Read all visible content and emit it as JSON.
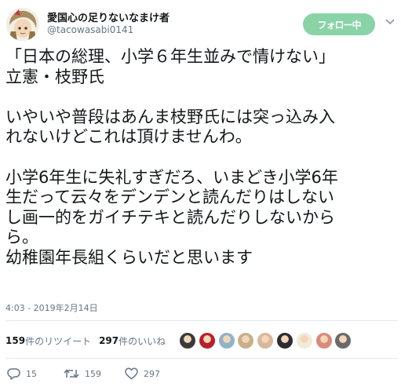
{
  "author": {
    "display_name": "愛国心の足りないなまけ者",
    "handle": "@tacowasabi0141",
    "follow_label": "フォロー中"
  },
  "tweet": {
    "lines": [
      "「日本の総理、小学６年生並みで情けない」",
      "立憲・枝野氏",
      "",
      "いやいや普段はあんま枝野氏には突っ込み入",
      "れないけどこれは頂けませんわ。",
      "",
      "小学6年生に失礼すぎだろ、いまどき小学6年",
      "生だって云々をデンデンと読んだりはしない",
      "し画一的をガイチテキと読んだりしないから",
      "ら。",
      "幼稚園年長組くらいだと思います"
    ],
    "timestamp": "4:03 - 2019年2月14日"
  },
  "stats": {
    "retweet_count": "159",
    "retweet_label": "件のリツイート",
    "like_count": "297",
    "like_label": "件のいいね"
  },
  "liker_avatars": [
    {
      "color": "#3a3a3a"
    },
    {
      "color": "#b8202a"
    },
    {
      "color": "#8fb3c9"
    },
    {
      "color": "#c9b08a"
    },
    {
      "color": "#d9b89a"
    },
    {
      "color": "#2c2c30"
    },
    {
      "color": "#f1ead8"
    },
    {
      "color": "#d98a7a"
    },
    {
      "color": "#6a6a6a"
    }
  ],
  "actions": {
    "reply_count": "15",
    "retweet_count": "159",
    "like_count": "297"
  },
  "colors": {
    "follow_button": "#8ad3a7",
    "secondary_text": "#657786",
    "divider": "#e1e8ed"
  }
}
